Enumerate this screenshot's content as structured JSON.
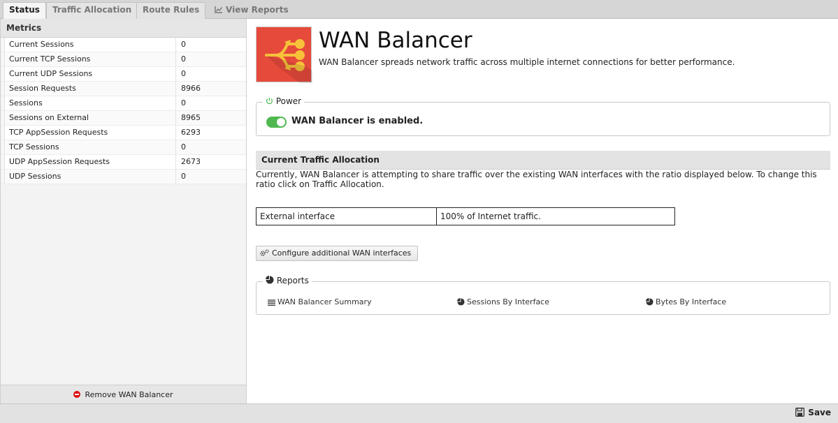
{
  "tabs": [
    {
      "label": "Status",
      "active": true
    },
    {
      "label": "Traffic Allocation",
      "active": false
    },
    {
      "label": "Route Rules",
      "active": false
    },
    {
      "label": "View Reports",
      "icon": "line-chart-icon",
      "active": false
    }
  ],
  "metrics": {
    "title": "Metrics",
    "rows": [
      {
        "name": "Current Sessions",
        "value": "0"
      },
      {
        "name": "Current TCP Sessions",
        "value": "0"
      },
      {
        "name": "Current UDP Sessions",
        "value": "0"
      },
      {
        "name": "Session Requests",
        "value": "8966"
      },
      {
        "name": "Sessions",
        "value": "0"
      },
      {
        "name": "Sessions on External",
        "value": "8965"
      },
      {
        "name": "TCP AppSession Requests",
        "value": "6293"
      },
      {
        "name": "TCP Sessions",
        "value": "0"
      },
      {
        "name": "UDP AppSession Requests",
        "value": "2673"
      },
      {
        "name": "UDP Sessions",
        "value": "0"
      }
    ],
    "remove_label": "Remove WAN Balancer"
  },
  "app": {
    "title": "WAN Balancer",
    "description": "WAN Balancer spreads network traffic across multiple internet connections for better performance.",
    "icon": "wan-balancer-logo-icon",
    "icon_color": "#e64a3b"
  },
  "power": {
    "legend": "Power",
    "status": "WAN Balancer is enabled.",
    "enabled": true
  },
  "allocation": {
    "heading": "Current Traffic Allocation",
    "text": "Currently, WAN Balancer is attempting to share traffic over the existing WAN interfaces with the ratio displayed below. To change this ratio click on Traffic Allocation.",
    "rows": [
      {
        "interface": "External interface",
        "share": "100% of Internet traffic."
      }
    ],
    "configure_label": "Configure additional WAN interfaces"
  },
  "reports": {
    "legend": "Reports",
    "links": [
      {
        "label": "WAN Balancer Summary",
        "icon": "list-icon"
      },
      {
        "label": "Sessions By Interface",
        "icon": "pie-chart-icon"
      },
      {
        "label": "Bytes By Interface",
        "icon": "pie-chart-icon"
      }
    ]
  },
  "footer": {
    "save_label": "Save"
  },
  "colors": {
    "toggle_on": "#4fb84f",
    "remove": "#dd1111"
  }
}
